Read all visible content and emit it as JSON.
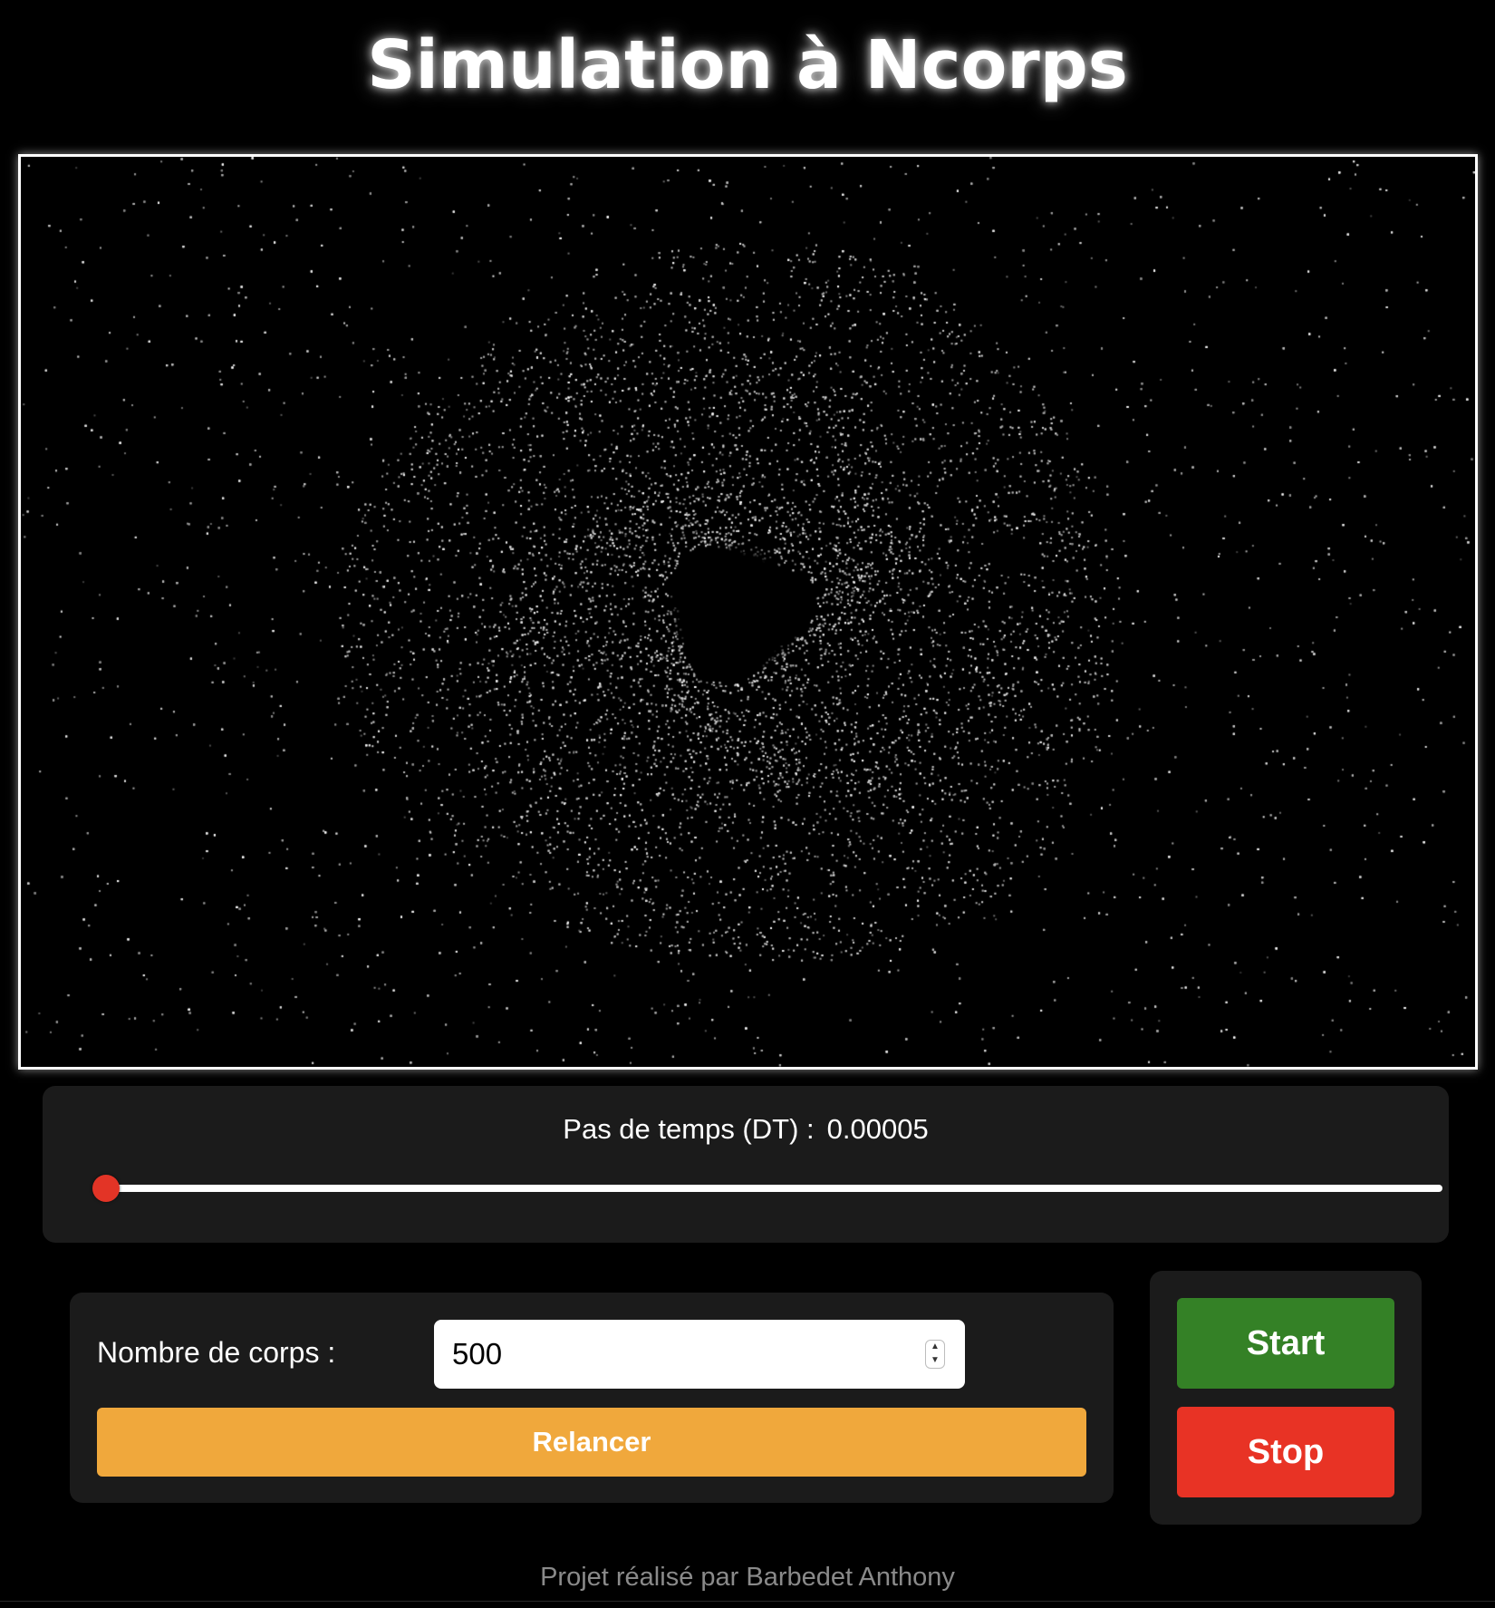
{
  "page": {
    "title": "Simulation à Ncorps"
  },
  "timestep": {
    "label": "Pas de temps (DT) :",
    "value": "0.00005",
    "slider_fraction": 0.0
  },
  "bodies": {
    "label": "Nombre de corps :",
    "value": "500",
    "relaunch_label": "Relancer"
  },
  "controls": {
    "start_label": "Start",
    "stop_label": "Stop"
  },
  "footer": {
    "credit": "Projet réalisé par Barbedet Anthony"
  },
  "colors": {
    "background": "#000000",
    "panel": "#1b1b1b",
    "slider_thumb": "#e33426",
    "relaunch": "#f0a83c",
    "start": "#348126",
    "stop": "#e83325"
  }
}
